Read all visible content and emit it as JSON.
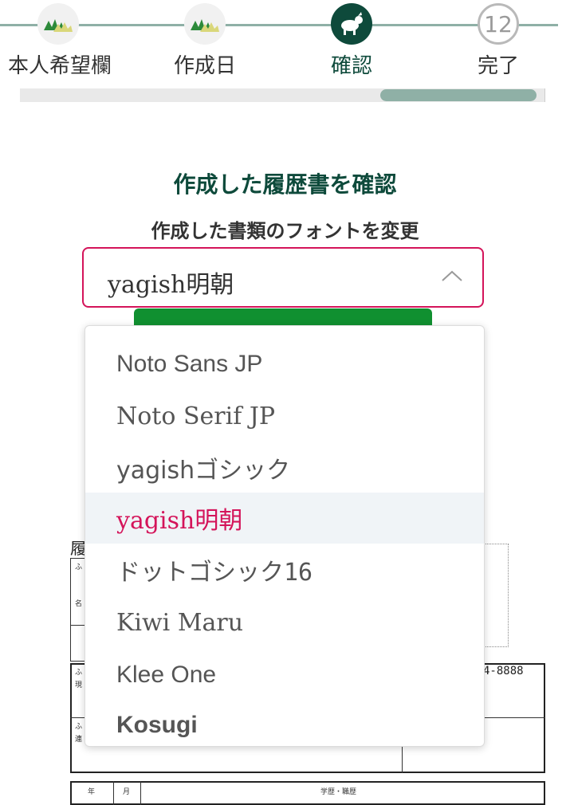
{
  "stepper": {
    "steps": [
      {
        "label": "本人希望欄",
        "status": "done"
      },
      {
        "label": "作成日",
        "status": "done"
      },
      {
        "label": "確認",
        "status": "current"
      },
      {
        "label": "完了",
        "status": "future",
        "number": "12"
      }
    ],
    "colors": {
      "line": "#8fb0a6",
      "current": "#0e4a3b"
    }
  },
  "page": {
    "title": "作成した履歴書を確認",
    "font_label": "作成した書類のフォントを変更"
  },
  "font_select": {
    "selected": "yagish明朝",
    "options": [
      "Noto Sans JP",
      "Noto Serif JP",
      "yagishゴシック",
      "yagish明朝",
      "ドットゴシック16",
      "Kiwi Maru",
      "Klee One",
      "Kosugi"
    ],
    "accent_color": "#d4145a"
  },
  "resume": {
    "title": "履",
    "furigana_mark": "ふ",
    "name_mark": "名",
    "address_mark": "現",
    "contact_mark": "連",
    "phone_suffix": "4-8888",
    "col_year": "年",
    "col_month": "月",
    "col_history": "学歴・職歴"
  }
}
